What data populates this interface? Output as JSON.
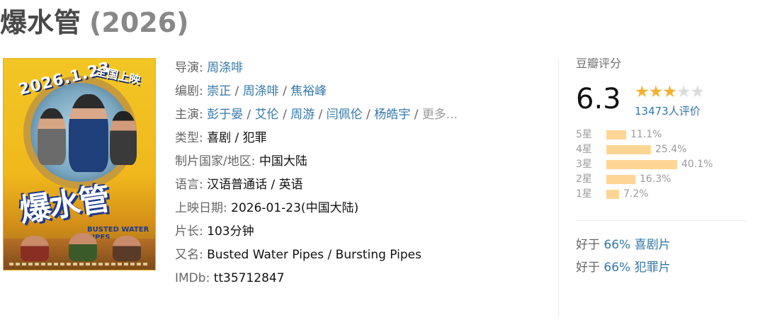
{
  "title": {
    "name": "爆水管",
    "year": "(2026)"
  },
  "poster": {
    "date_text": "2026.1.23",
    "release_text": "全国上映",
    "logo_text": "爆水管",
    "logo_sub": "BUSTED WATER PIPES"
  },
  "info": {
    "director": {
      "label": "导演",
      "values": [
        "周涤啡"
      ]
    },
    "writers": {
      "label": "编剧",
      "values": [
        "崇正",
        "周涤啡",
        "焦裕峰"
      ]
    },
    "cast": {
      "label": "主演",
      "values": [
        "彭于晏",
        "艾伦",
        "周游",
        "闫佩伦",
        "杨皓宇"
      ],
      "more": "更多..."
    },
    "genre": {
      "label": "类型:",
      "value": "喜剧 / 犯罪"
    },
    "country": {
      "label": "制片国家/地区:",
      "value": "中国大陆"
    },
    "language": {
      "label": "语言:",
      "value": "汉语普通话 / 英语"
    },
    "release": {
      "label": "上映日期:",
      "value": "2026-01-23(中国大陆)"
    },
    "runtime": {
      "label": "片长:",
      "value": "103分钟"
    },
    "aka": {
      "label": "又名:",
      "value": "Busted Water Pipes / Bursting Pipes"
    },
    "imdb": {
      "label": "IMDb:",
      "value": "tt35712847"
    }
  },
  "rating": {
    "title": "豆瓣评分",
    "score": "6.3",
    "stars_filled": 3,
    "stars_total": 5,
    "votes": "13473人评价",
    "distribution": [
      {
        "label": "5星",
        "pct": "11.1%",
        "value": 11.1
      },
      {
        "label": "4星",
        "pct": "25.4%",
        "value": 25.4
      },
      {
        "label": "3星",
        "pct": "40.1%",
        "value": 40.1
      },
      {
        "label": "2星",
        "pct": "16.3%",
        "value": 16.3
      },
      {
        "label": "1星",
        "pct": "7.2%",
        "value": 7.2
      }
    ],
    "better_than": [
      {
        "prefix": "好于",
        "text": "66% 喜剧片"
      },
      {
        "prefix": "好于",
        "text": "66% 犯罪片"
      }
    ]
  },
  "colors": {
    "link": "#3377aa",
    "star": "#f5b031",
    "bar": "#ffd596"
  }
}
